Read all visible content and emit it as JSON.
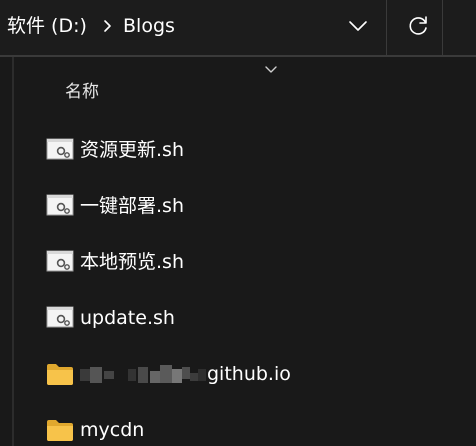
{
  "address_bar": {
    "drive": "软件 (D:)",
    "folder": "Blogs",
    "separator_icon": "chevron-right-icon",
    "dropdown_icon": "chevron-down-icon",
    "refresh_icon": "refresh-icon"
  },
  "file_list": {
    "sort_indicator_icon": "chevron-down-icon",
    "column_header": "名称",
    "items": [
      {
        "name": "资源更新.sh",
        "type": "file",
        "icon": "shell-script-icon"
      },
      {
        "name": "一键部署.sh",
        "type": "file",
        "icon": "shell-script-icon"
      },
      {
        "name": "本地预览.sh",
        "type": "file",
        "icon": "shell-script-icon"
      },
      {
        "name": "update.sh",
        "type": "file",
        "icon": "shell-script-icon"
      },
      {
        "name": "github.io",
        "type": "folder",
        "icon": "folder-icon",
        "name_prefix_redacted": true
      },
      {
        "name": "mycdn",
        "type": "folder",
        "icon": "folder-icon"
      }
    ]
  },
  "colors": {
    "background": "#191919",
    "folder": "#f7c34a",
    "text": "#ffffff"
  }
}
